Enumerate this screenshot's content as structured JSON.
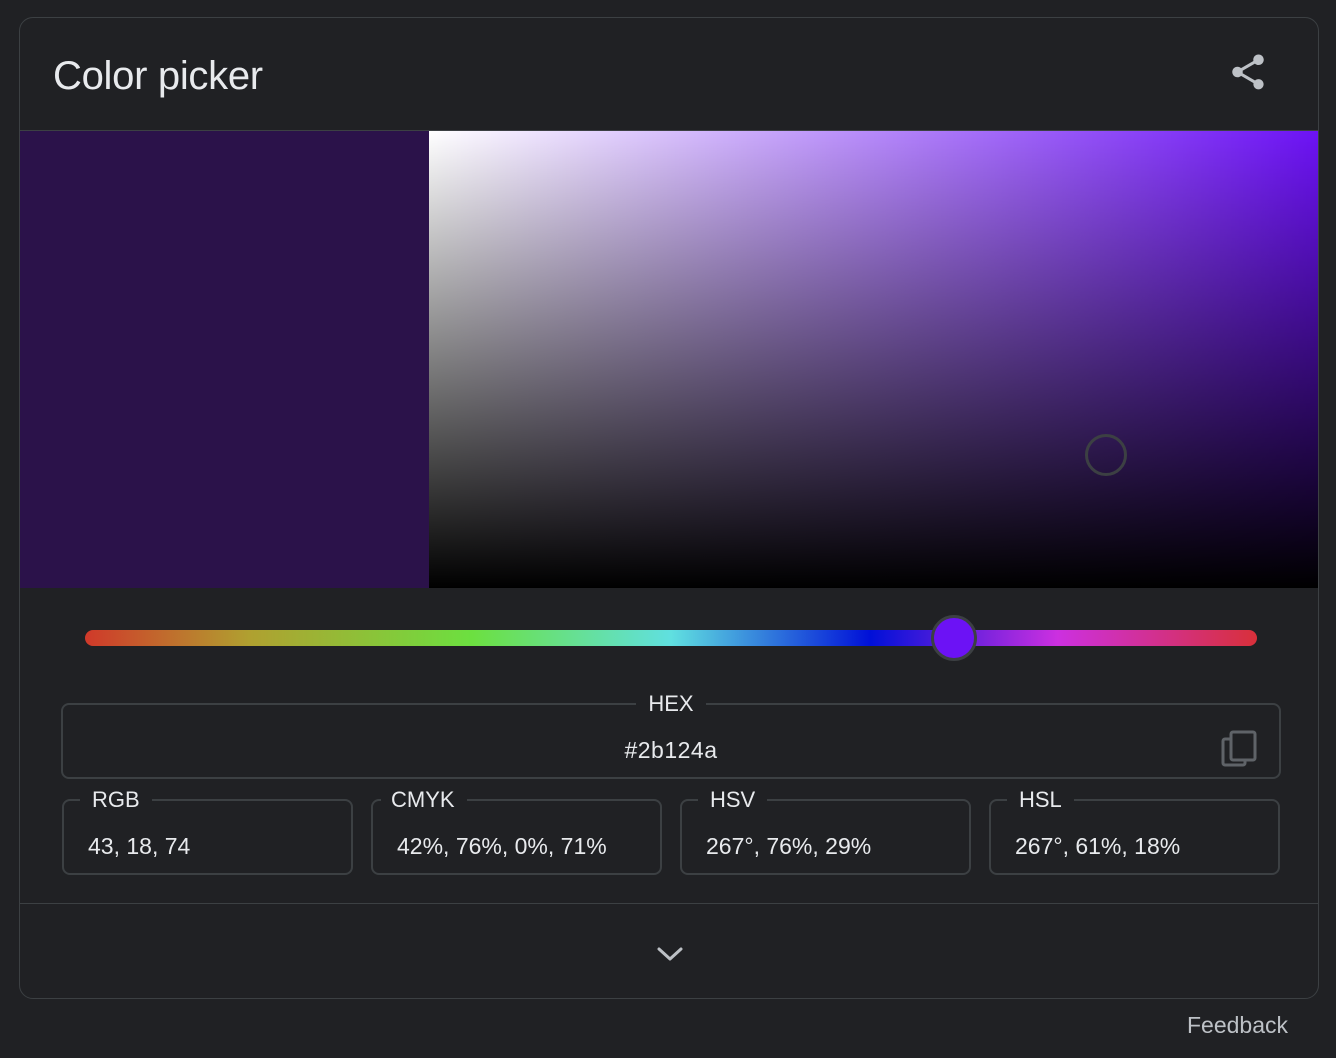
{
  "widget": {
    "title": "Color picker",
    "share_icon": "share-icon",
    "expand_icon": "chevron-down-icon"
  },
  "color": {
    "selected_hex_color": "#2b124a",
    "hue_color": "#6c12f5",
    "hue_degrees": 267,
    "saturation": 0.76,
    "value": 0.29
  },
  "fields": {
    "hex": {
      "label": "HEX",
      "value": "#2b124a",
      "copy_icon": "copy-icon"
    },
    "rgb": {
      "label": "RGB",
      "value": "43, 18, 74"
    },
    "cmyk": {
      "label": "CMYK",
      "value": "42%, 76%, 0%, 71%"
    },
    "hsv": {
      "label": "HSV",
      "value": "267°, 76%, 29%"
    },
    "hsl": {
      "label": "HSL",
      "value": "267°, 61%, 18%"
    }
  },
  "footer": {
    "feedback_label": "Feedback"
  },
  "colors": {
    "background": "#202124",
    "border": "#3c4043",
    "text": "#e8eaed",
    "muted_text": "#bdc1c6"
  }
}
